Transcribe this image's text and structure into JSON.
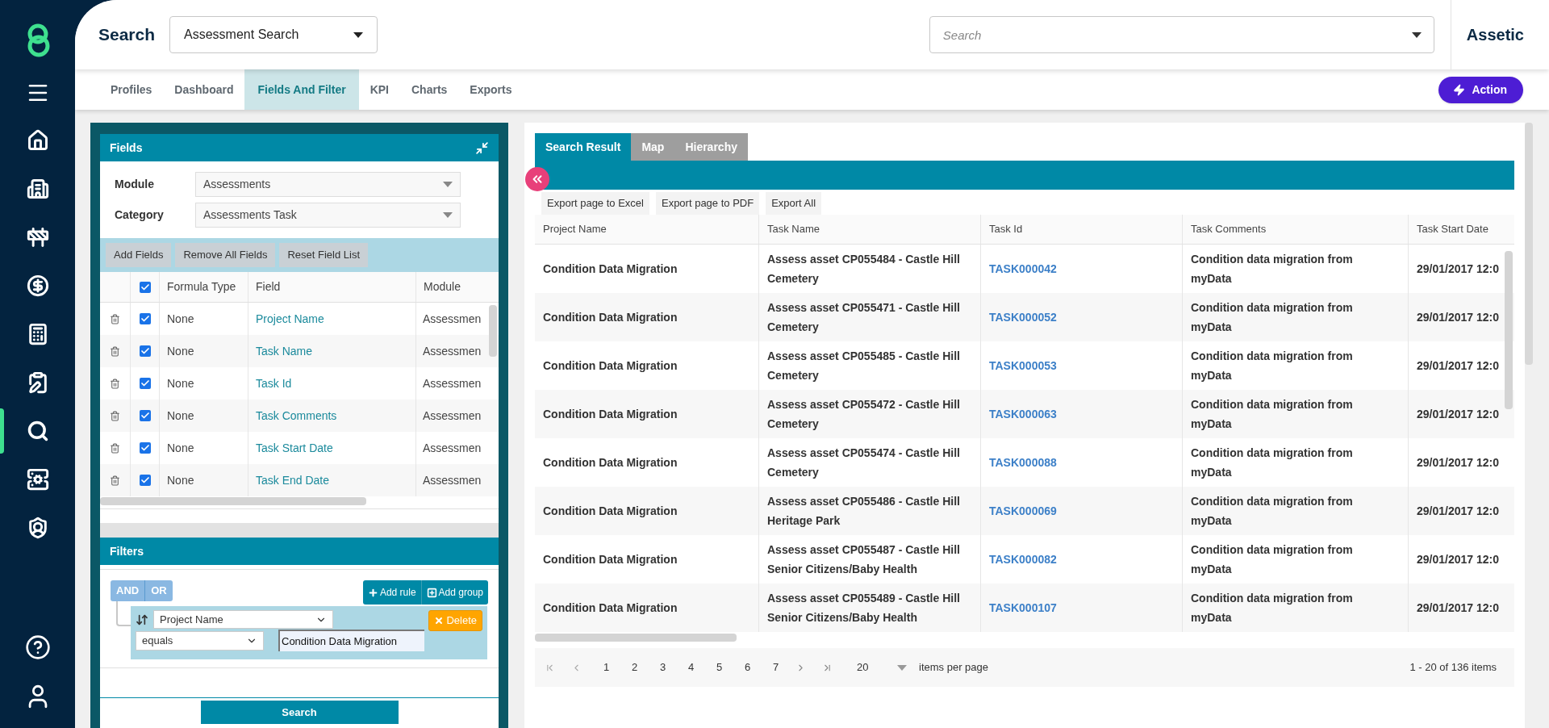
{
  "sidebar": {
    "nav": [
      {
        "selected": false
      },
      {
        "selected": false
      },
      {
        "selected": false
      },
      {
        "selected": false
      },
      {
        "selected": false
      },
      {
        "selected": false
      },
      {
        "selected": true
      },
      {
        "selected": false
      },
      {
        "selected": false
      }
    ]
  },
  "header": {
    "title": "Search",
    "search_type": {
      "value": "Assessment Search"
    },
    "global_search": {
      "placeholder": "Search"
    },
    "brand": "Assetic"
  },
  "tabs": [
    {
      "label": "Profiles",
      "selected": false
    },
    {
      "label": "Dashboard",
      "selected": false
    },
    {
      "label": "Fields And Filter",
      "selected": true
    },
    {
      "label": "KPI",
      "selected": false
    },
    {
      "label": "Charts",
      "selected": false
    },
    {
      "label": "Exports",
      "selected": false
    }
  ],
  "action_button": "Action",
  "fields_panel": {
    "title": "Fields",
    "module": {
      "label": "Module",
      "value": "Assessments"
    },
    "category": {
      "label": "Category",
      "value": "Assessments Task"
    },
    "buttons": [
      "Add Fields",
      "Remove All Fields",
      "Reset Field List"
    ],
    "columns": [
      "Formula Type",
      "Field",
      "Module"
    ],
    "header_checked": true,
    "rows": [
      {
        "checked": true,
        "formula_type": "None",
        "field": "Project Name",
        "module": "Assessmen"
      },
      {
        "checked": true,
        "formula_type": "None",
        "field": "Task Name",
        "module": "Assessmen"
      },
      {
        "checked": true,
        "formula_type": "None",
        "field": "Task Id",
        "module": "Assessmen"
      },
      {
        "checked": true,
        "formula_type": "None",
        "field": "Task Comments",
        "module": "Assessmen"
      },
      {
        "checked": true,
        "formula_type": "None",
        "field": "Task Start Date",
        "module": "Assessmen"
      },
      {
        "checked": true,
        "formula_type": "None",
        "field": "Task End Date",
        "module": "Assessmen"
      }
    ]
  },
  "filters_panel": {
    "title": "Filters",
    "conjunctions": [
      "AND",
      "OR"
    ],
    "add_buttons": [
      "Add rule",
      "Add group"
    ],
    "rule": {
      "field": "Project Name",
      "operator": "equals",
      "value": "Condition Data Migration",
      "delete": "Delete"
    },
    "search_button": "Search"
  },
  "results": {
    "tabs": [
      {
        "label": "Search Result",
        "selected": true
      },
      {
        "label": "Map",
        "selected": false
      },
      {
        "label": "Hierarchy",
        "selected": false
      }
    ],
    "export_buttons": [
      "Export page to Excel",
      "Export page to PDF",
      "Export All"
    ],
    "columns": [
      "Project Name",
      "Task Name",
      "Task Id",
      "Task Comments",
      "Task Start Date"
    ],
    "rows": [
      {
        "project": "Condition Data Migration",
        "task_name": "Assess asset CP055484 - Castle Hill Cemetery",
        "task_id": "TASK000042",
        "comments": "Condition data migration from myData",
        "start": "29/01/2017 12:0"
      },
      {
        "project": "Condition Data Migration",
        "task_name": "Assess asset CP055471 - Castle Hill Cemetery",
        "task_id": "TASK000052",
        "comments": "Condition data migration from myData",
        "start": "29/01/2017 12:0"
      },
      {
        "project": "Condition Data Migration",
        "task_name": "Assess asset CP055485 - Castle Hill Cemetery",
        "task_id": "TASK000053",
        "comments": "Condition data migration from myData",
        "start": "29/01/2017 12:0"
      },
      {
        "project": "Condition Data Migration",
        "task_name": "Assess asset CP055472 - Castle Hill Cemetery",
        "task_id": "TASK000063",
        "comments": "Condition data migration from myData",
        "start": "29/01/2017 12:0"
      },
      {
        "project": "Condition Data Migration",
        "task_name": "Assess asset CP055474 - Castle Hill Cemetery",
        "task_id": "TASK000088",
        "comments": "Condition data migration from myData",
        "start": "29/01/2017 12:0"
      },
      {
        "project": "Condition Data Migration",
        "task_name": "Assess asset CP055486 - Castle Hill Heritage Park",
        "task_id": "TASK000069",
        "comments": "Condition data migration from myData",
        "start": "29/01/2017 12:0"
      },
      {
        "project": "Condition Data Migration",
        "task_name": "Assess asset CP055487 - Castle Hill Senior Citizens/Baby Health",
        "task_id": "TASK000082",
        "comments": "Condition data migration from myData",
        "start": "29/01/2017 12:0"
      },
      {
        "project": "Condition Data Migration",
        "task_name": "Assess asset CP055489 - Castle Hill Senior Citizens/Baby Health",
        "task_id": "TASK000107",
        "comments": "Condition data migration from myData",
        "start": "29/01/2017 12:0"
      }
    ],
    "pager": {
      "pages": [
        "1",
        "2",
        "3",
        "4",
        "5",
        "6",
        "7"
      ],
      "page_size": "20",
      "page_size_label": "items per page",
      "summary": "1 - 20 of 136 items"
    }
  }
}
